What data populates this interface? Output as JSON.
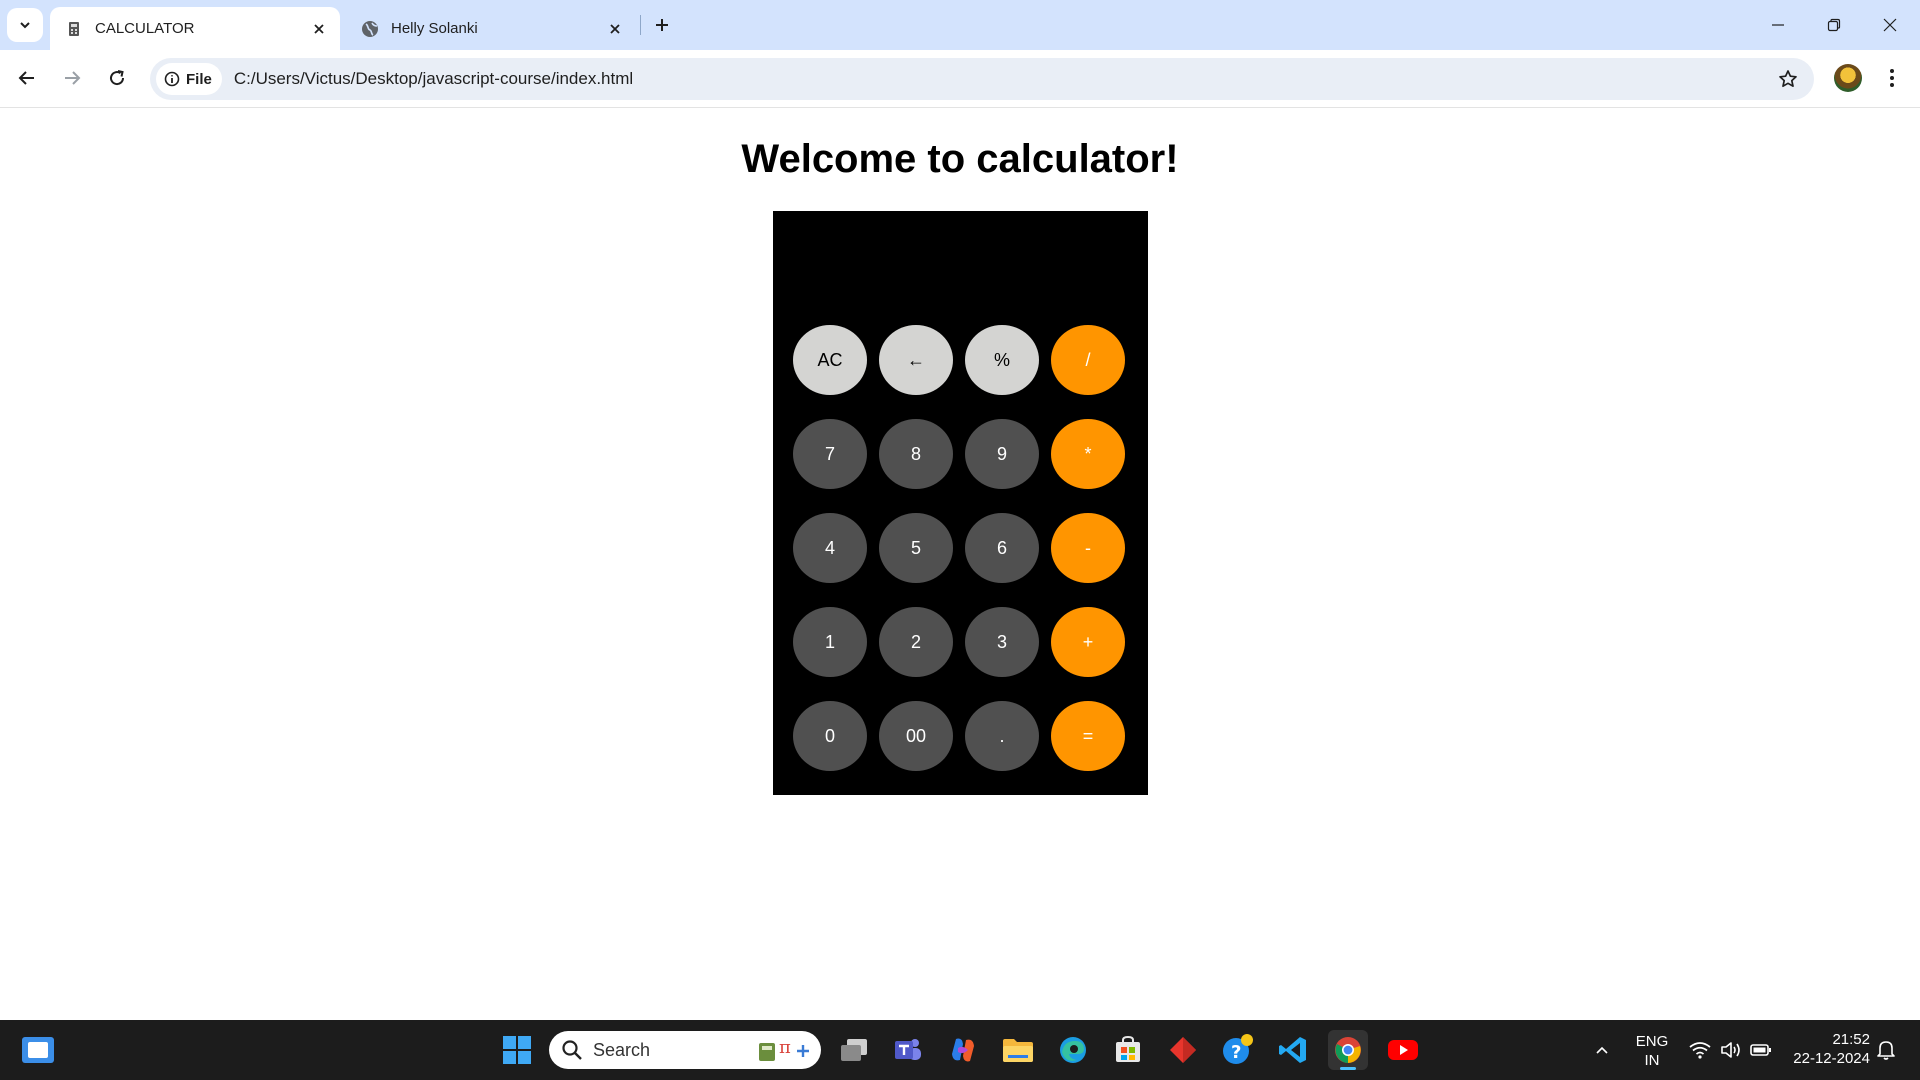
{
  "browser": {
    "tabs": [
      {
        "title": "CALCULATOR",
        "active": true
      },
      {
        "title": "Helly Solanki",
        "active": false
      }
    ],
    "address": {
      "scheme_chip": "File",
      "url": "C:/Users/Victus/Desktop/javascript-course/index.html"
    }
  },
  "page": {
    "heading": "Welcome to calculator!",
    "display_value": "",
    "buttons": [
      {
        "label": "AC",
        "kind": "light"
      },
      {
        "label": "←",
        "kind": "light"
      },
      {
        "label": "%",
        "kind": "light"
      },
      {
        "label": "/",
        "kind": "op"
      },
      {
        "label": "7",
        "kind": "dark"
      },
      {
        "label": "8",
        "kind": "dark"
      },
      {
        "label": "9",
        "kind": "dark"
      },
      {
        "label": "*",
        "kind": "op"
      },
      {
        "label": "4",
        "kind": "dark"
      },
      {
        "label": "5",
        "kind": "dark"
      },
      {
        "label": "6",
        "kind": "dark"
      },
      {
        "label": "-",
        "kind": "op"
      },
      {
        "label": "1",
        "kind": "dark"
      },
      {
        "label": "2",
        "kind": "dark"
      },
      {
        "label": "3",
        "kind": "dark"
      },
      {
        "label": "+",
        "kind": "op"
      },
      {
        "label": "0",
        "kind": "dark"
      },
      {
        "label": "00",
        "kind": "dark"
      },
      {
        "label": ".",
        "kind": "dark"
      },
      {
        "label": "=",
        "kind": "op"
      }
    ],
    "colors": {
      "light": "#d4d4d2",
      "dark": "#505050",
      "operator": "#ff9500",
      "panel": "#000000"
    }
  },
  "taskbar": {
    "search_label": "Search",
    "language": "ENG",
    "region": "IN",
    "time": "21:52",
    "date": "22-12-2024",
    "pinned_apps": [
      "task-view",
      "teams",
      "copilot",
      "file-explorer",
      "edge",
      "microsoft-store",
      "git",
      "get-help",
      "vscode",
      "chrome",
      "youtube"
    ]
  }
}
